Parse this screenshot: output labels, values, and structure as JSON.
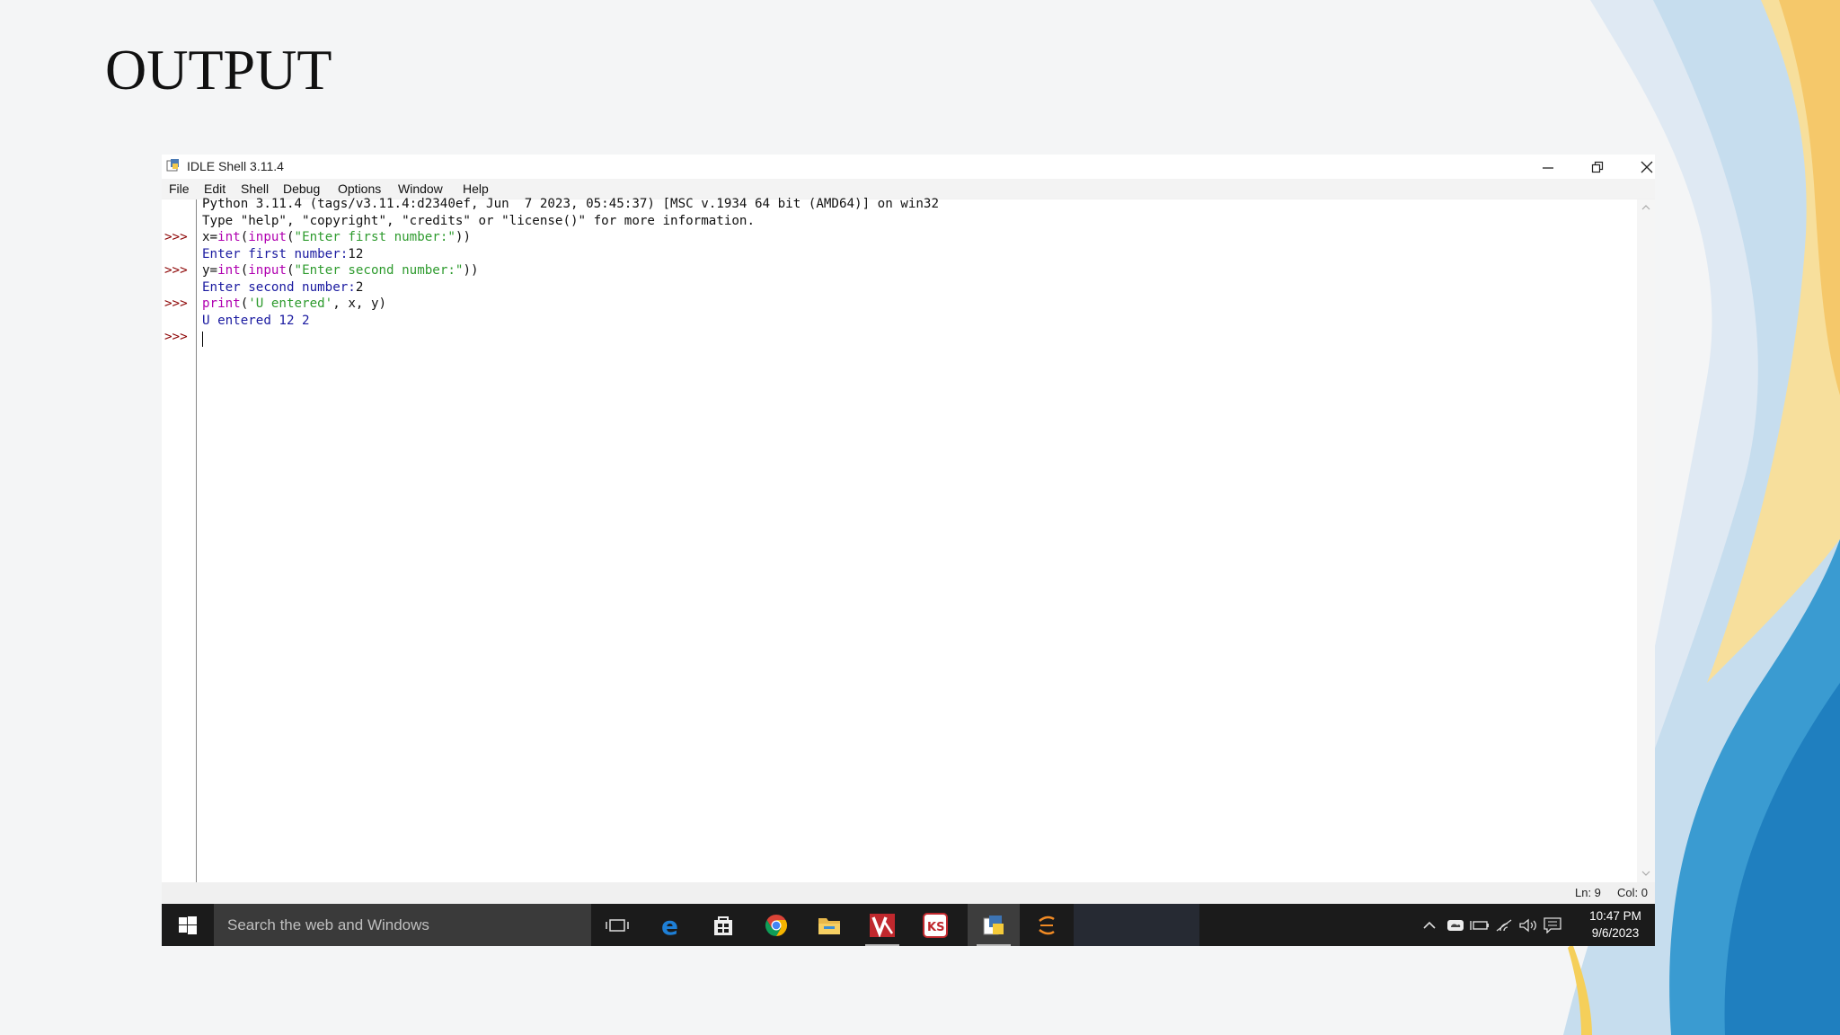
{
  "slide": {
    "title": "OUTPUT"
  },
  "window": {
    "title": "IDLE Shell 3.11.4",
    "menu": [
      "File",
      "Edit",
      "Shell",
      "Debug",
      "Options",
      "Window",
      "Help"
    ],
    "controls": {
      "minimize": "minimize-icon",
      "restore": "restore-icon",
      "close": "close-icon"
    }
  },
  "shell": {
    "banner_line1": "Python 3.11.4 (tags/v3.11.4:d2340ef, Jun  7 2023, 05:45:37) [MSC v.1934 64 bit (AMD64)] on win32",
    "banner_line2": "Type \"help\", \"copyright\", \"credits\" or \"license()\" for more information.",
    "prompt": ">>>",
    "line1": {
      "a": "x=",
      "b": "int",
      "c": "(",
      "d": "input",
      "e": "(",
      "f": "\"Enter first number:\"",
      "g": "))"
    },
    "out1": "Enter first number:",
    "in1": "12",
    "line2": {
      "a": "y=",
      "b": "int",
      "c": "(",
      "d": "input",
      "e": "(",
      "f": "\"Enter second number:\"",
      "g": "))"
    },
    "out2": "Enter second number:",
    "in2": "2",
    "line3": {
      "a": "print",
      "b": "(",
      "c": "'U entered'",
      "d": ", x, y)"
    },
    "out3": "U entered 12 2"
  },
  "status": {
    "line": "Ln: 9",
    "col": "Col: 0"
  },
  "taskbar": {
    "search_placeholder": "Search the web and Windows",
    "apps": [
      "task-view-icon",
      "edge-icon",
      "store-icon",
      "chrome-icon",
      "file-explorer-icon",
      "app-v-icon",
      "app-ks-icon",
      "python-idle-icon",
      "sublime-icon"
    ],
    "time": "10:47 PM",
    "date": "9/6/2023"
  }
}
